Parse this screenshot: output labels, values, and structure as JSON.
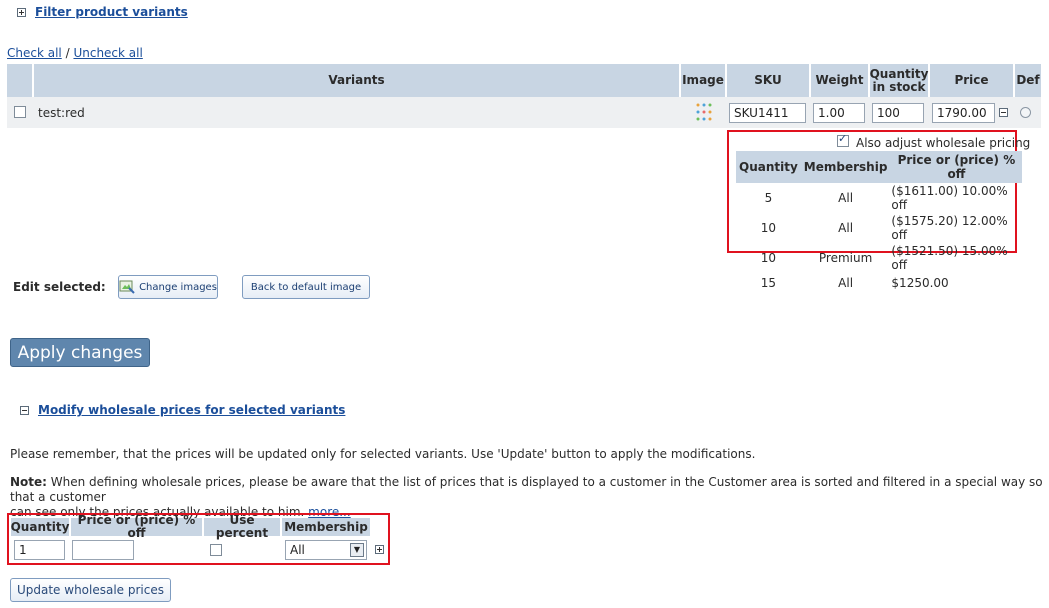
{
  "filter": {
    "label": "Filter product variants"
  },
  "selection": {
    "check_all": "Check all",
    "separator": "/",
    "uncheck_all": "Uncheck all"
  },
  "table": {
    "headers": {
      "variants": "Variants",
      "image": "Image",
      "sku": "SKU",
      "weight": "Weight",
      "qty_line1": "Quantity",
      "qty_line2": "in stock",
      "price": "Price",
      "def": "Def"
    },
    "row": {
      "name": "test:red",
      "sku": "SKU1411",
      "weight": "1.00",
      "quantity": "100",
      "price": "1790.00"
    }
  },
  "wholesale_preview": {
    "adjust_label": "Also adjust wholesale pricing",
    "headers": [
      "Quantity",
      "Membership",
      "Price or (price) % off"
    ],
    "rows": [
      {
        "qty": "5",
        "membership": "All",
        "price": "($1611.00) 10.00% off"
      },
      {
        "qty": "10",
        "membership": "All",
        "price": "($1575.20) 12.00% off"
      },
      {
        "qty": "10",
        "membership": "Premium",
        "price": "($1521.50) 15.00% off"
      },
      {
        "qty": "15",
        "membership": "All",
        "price": "$1250.00"
      }
    ]
  },
  "edit": {
    "label": "Edit selected:",
    "change_images": "Change images",
    "back_default": "Back to default image"
  },
  "apply": {
    "label": "Apply changes"
  },
  "modify": {
    "title": "Modify wholesale prices for selected variants",
    "reminder": "Please remember, that the prices will be updated only for selected variants. Use 'Update' button to apply the modifications.",
    "note_label": "Note:",
    "note_line1": " When defining wholesale prices, please be aware that the list of prices that is displayed to a customer in the Customer area is sorted and filtered in a special way so that a customer",
    "note_line2": "can see only the prices actually available to him.",
    "more": "more..."
  },
  "new_price": {
    "headers": {
      "quantity": "Quantity",
      "price": "Price or (price) % off",
      "use_percent": "Use percent",
      "membership": "Membership"
    },
    "quantity_value": "1",
    "price_value": "",
    "membership_selected": "All"
  },
  "update": {
    "label": "Update wholesale prices"
  },
  "colors": {
    "header_bg": "#c8d5e3",
    "highlight": "#e0121f",
    "apply_bg": "#5f86ad",
    "link": "#1b4e9a"
  }
}
